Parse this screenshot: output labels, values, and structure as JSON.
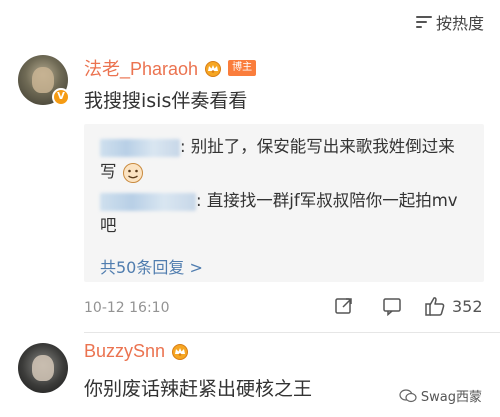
{
  "sort": {
    "label": "按热度",
    "icon": "sort-lines-icon"
  },
  "comments": [
    {
      "username": "法老_Pharaoh",
      "author_tag": "博主",
      "verified_badge": "V",
      "text": "我搜搜isis伴奏看看",
      "replies": [
        {
          "user_masked": true,
          "text": ": 别扯了，保安能写出来歌我姓倒过来写"
        },
        {
          "user_masked": true,
          "text": ": 直接找一群jf军叔叔陪你一起拍mv吧"
        }
      ],
      "more_replies": "共50条回复 >",
      "timestamp": "10-12 16:10",
      "likes": "352"
    },
    {
      "username": "BuzzySnn",
      "text": "你别废话辣赶紧出硬核之王"
    }
  ],
  "watermark": "Swag西蒙",
  "colors": {
    "username": "#eb7350",
    "link": "#507daf",
    "author_tag": "#fa7d3c",
    "badge": "#f59b13"
  }
}
